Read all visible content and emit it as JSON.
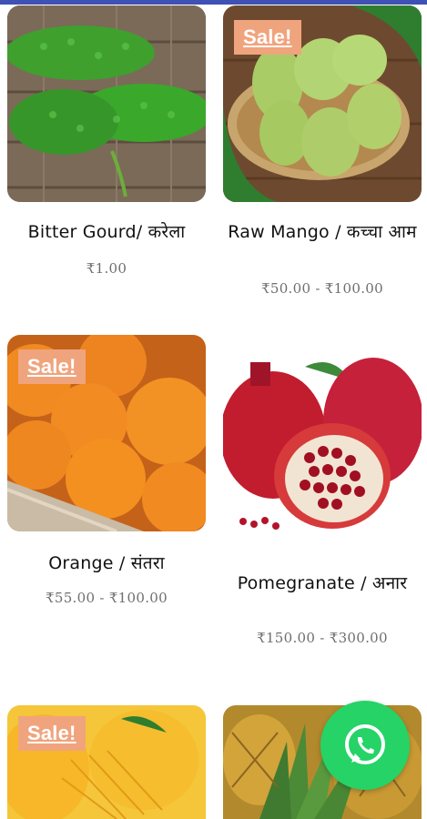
{
  "products": [
    {
      "name": "Bitter Gourd/ करेला",
      "price": "₹1.00",
      "badge": ""
    },
    {
      "name": "Raw Mango / कच्चा आम",
      "price": "₹50.00 - ₹100.00",
      "badge": "Sale!"
    },
    {
      "name": "Orange / संतरा",
      "price": "₹55.00 - ₹100.00",
      "badge": "Sale!"
    },
    {
      "name": "Pomegranate / अनार",
      "price": "₹150.00 - ₹300.00",
      "badge": ""
    },
    {
      "name": "",
      "price": "",
      "badge": "Sale!"
    },
    {
      "name": "",
      "price": "",
      "badge": ""
    }
  ],
  "colors": {
    "sale_badge": "#f0a47d",
    "whatsapp": "#25d366",
    "topbar": "#3f51b5"
  },
  "icons": {
    "floating_button": "whatsapp-icon"
  }
}
